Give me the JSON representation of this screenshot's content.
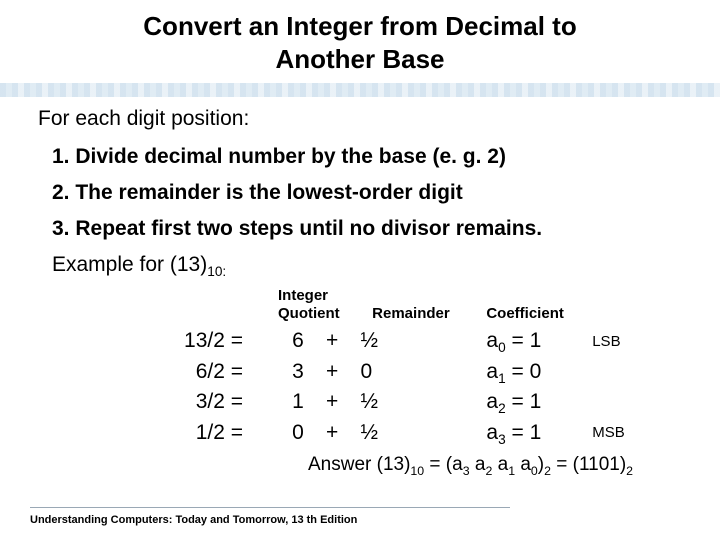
{
  "title_line1": "Convert an Integer from Decimal to",
  "title_line2": "Another Base",
  "intro": "For each digit position:",
  "steps": {
    "s1": "1.  Divide decimal number by the base (e. g. 2)",
    "s2": "2.  The remainder is the lowest-order digit",
    "s3": "3.  Repeat first two steps until no divisor remains."
  },
  "example_label": "Example for (13)",
  "example_sub": "10:",
  "headers": {
    "iq1": "Integer",
    "iq2": "Quotient",
    "rem": "Remainder",
    "coef": "Coefficient"
  },
  "rows": [
    {
      "div": "13/2 =",
      "q": "6",
      "plus": "+",
      "r": "½",
      "coef_a": "a",
      "coef_i": "0",
      "coef_eq": " = 1",
      "tag": "LSB"
    },
    {
      "div": "6/2 =",
      "q": "3",
      "plus": "+",
      "r": "0",
      "coef_a": "a",
      "coef_i": "1",
      "coef_eq": " = 0",
      "tag": ""
    },
    {
      "div": "3/2 =",
      "q": "1",
      "plus": "+",
      "r": "½",
      "coef_a": "a",
      "coef_i": "2",
      "coef_eq": " = 1",
      "tag": ""
    },
    {
      "div": "1/2 =",
      "q": "0",
      "plus": "+",
      "r": "½",
      "coef_a": "a",
      "coef_i": "3",
      "coef_eq": " = 1",
      "tag": "MSB"
    }
  ],
  "answer": {
    "pre": "Answer (13)",
    "sub1": "10",
    "mid1": " = (a",
    "a3": "3",
    "sp1": " a",
    "a2": "2",
    "sp2": " a",
    "a1": "1",
    "sp3": " a",
    "a0": "0",
    "mid2": ")",
    "sub2": "2",
    "mid3": " = (1101)",
    "sub3": "2"
  },
  "footer": "Understanding Computers: Today and Tomorrow, 13 th Edition"
}
